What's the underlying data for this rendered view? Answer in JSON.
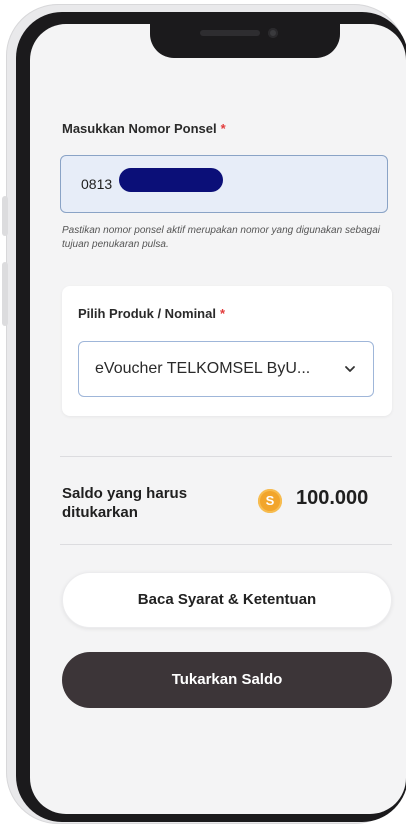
{
  "phone": {
    "label": "Masukkan Nomor Ponsel",
    "required_mark": "*",
    "value": "0813",
    "hint": "Pastikan nomor ponsel aktif merupakan nomor yang digunakan sebagai tujuan penukaran pulsa."
  },
  "product": {
    "label": "Pilih Produk / Nominal",
    "required_mark": "*",
    "selected": "eVoucher TELKOMSEL ByU...",
    "icon": "chevron-down-icon"
  },
  "saldo": {
    "label": "Saldo yang harus ditukarkan",
    "coin_symbol": "S",
    "amount": "100.000"
  },
  "buttons": {
    "terms": "Baca Syarat & Ketentuan",
    "redeem": "Tukarkan Saldo"
  },
  "colors": {
    "required": "#e23b3b",
    "coin": "#f2a52b",
    "primary_button": "#3c3538",
    "input_active_bg": "#e7edf8"
  }
}
